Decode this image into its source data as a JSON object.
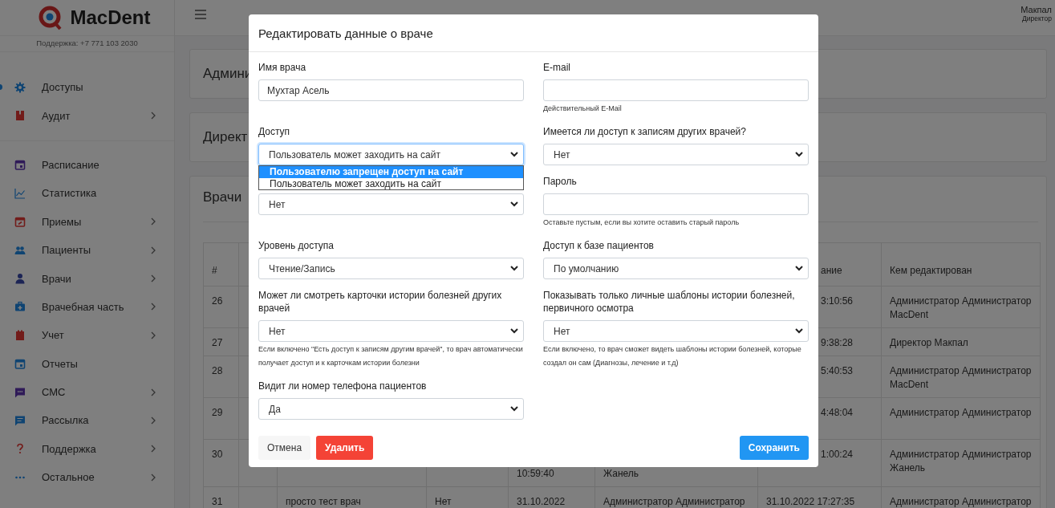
{
  "sidebar": {
    "logo": "MacDent",
    "support": "Поддержка: +7 771 103 2030",
    "groups": [
      [
        {
          "label": "Доступы",
          "expandable": false,
          "selected": true
        },
        {
          "label": "Аудит",
          "expandable": true,
          "selected": false
        }
      ],
      [
        {
          "label": "Расписание",
          "expandable": false,
          "selected": false
        },
        {
          "label": "Статистика",
          "expandable": false,
          "selected": false
        },
        {
          "label": "Приемы",
          "expandable": true,
          "selected": false
        },
        {
          "label": "Пациенты",
          "expandable": true,
          "selected": false
        },
        {
          "label": "Врачи",
          "expandable": true,
          "selected": false
        },
        {
          "label": "Врачебная часть",
          "expandable": true,
          "selected": false
        },
        {
          "label": "Учет",
          "expandable": true,
          "selected": false
        },
        {
          "label": "Отчеты",
          "expandable": false,
          "selected": false
        },
        {
          "label": "СМС",
          "expandable": true,
          "selected": false
        },
        {
          "label": "Рассылка",
          "expandable": true,
          "selected": false
        },
        {
          "label": "Поддержка",
          "expandable": true,
          "selected": false
        },
        {
          "label": "Остальное",
          "expandable": true,
          "selected": false
        }
      ]
    ]
  },
  "topbar": {
    "user_name": "Макпал",
    "user_role": "Директор"
  },
  "cards": [
    {
      "title": "Админи"
    },
    {
      "title": "Директ"
    }
  ],
  "doctors": {
    "title": "Врачи",
    "table": {
      "header": {
        "number": "#",
        "column_7_tail": "ание",
        "column_8": "Кем редактирован"
      },
      "rows": [
        {
          "number": "26",
          "column_7_tail": "3:10:56",
          "column_8": "Администратор Администратор MacDent"
        },
        {
          "number": "27",
          "column_7_tail": "9:38:28",
          "column_8": "Директор Макпал"
        },
        {
          "number": "28",
          "column_7_tail": "5:40:53",
          "column_8": "Администратор Администратор MacDent"
        },
        {
          "number": "29",
          "column_7_tail": "4:48:04",
          "column_8": "Администратор Администратор"
        },
        {
          "number": "30",
          "column_5_line2": "10:59:40",
          "column_6_line2": "Жанель",
          "column_7_tail": "1:00:24",
          "column_8": "Администратор Администратор Жанель"
        },
        {
          "number": "31",
          "column_3": "просто тест врач",
          "column_4": "Нет",
          "column_5": "31.10.2022",
          "column_6": "Администратор Администратор",
          "column_7": "31.10.2022 17:27:35",
          "column_8": "Администратор Администратор"
        }
      ]
    }
  },
  "modal": {
    "title": "Редактировать данные о враче",
    "rows": [
      [
        {
          "kind": "input",
          "label": "Имя врача",
          "value": "Мухтар Асель"
        },
        {
          "kind": "input",
          "label": "E-mail",
          "help": "Действительный E-Mail"
        }
      ],
      [
        {
          "kind": "select",
          "label": "Доступ",
          "value": "Пользователь может заходить на сайт",
          "focused": true,
          "open": true,
          "options": [
            {
              "label": "Пользователю запрещен доступ на сайт",
              "highlighted": true
            },
            {
              "label": "Пользователь может заходить на сайт",
              "highlighted": false
            }
          ]
        },
        {
          "kind": "select",
          "label": "Имеется ли доступ к записям других врачей?",
          "value": "Нет"
        }
      ],
      [
        {
          "kind": "select",
          "value": "Нет"
        },
        {
          "kind": "input",
          "label": "Пароль",
          "help": "Оставьте пустым, если вы хотите оставить старый пароль"
        }
      ],
      [
        {
          "kind": "select",
          "label": "Уровень доступа",
          "value": "Чтение/Запись"
        },
        {
          "kind": "select",
          "label": "Доступ к базе пациентов",
          "value": "По умолчанию"
        }
      ],
      [
        {
          "kind": "select",
          "label": "Может ли смотреть карточки истории болезней других врачей",
          "value": "Нет",
          "help": "Если включено \"Есть доступ к записям другим врачей\", то врач автоматически получает доступ и к карточкам истории болезни"
        },
        {
          "kind": "select",
          "label": "Показывать только личные шаблоны истории болезней, первичного осмотра",
          "value": "Нет",
          "help": "Если включено, то врач сможет видеть шаблоны истории болезней, которые создал он сам (Диагнозы, лечение и т.д)"
        }
      ],
      [
        {
          "kind": "select",
          "label": "Видит ли номер телефона пациентов",
          "value": "Да"
        }
      ]
    ],
    "buttons": [
      {
        "label": "Отмена",
        "kind": "secondary"
      },
      {
        "label": "Удалить",
        "kind": "danger"
      },
      {
        "label": "Сохранить",
        "kind": "primary"
      }
    ]
  }
}
